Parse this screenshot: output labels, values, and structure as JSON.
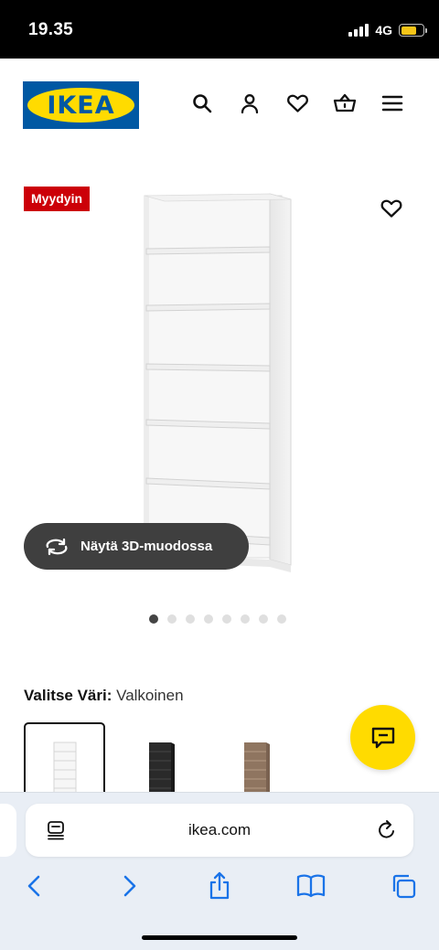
{
  "status_bar": {
    "time": "19.35",
    "network": "4G",
    "battery_level": 0.7
  },
  "header": {
    "logo_text": "IKEA",
    "icons": [
      "search-icon",
      "user-icon",
      "heart-icon",
      "basket-icon",
      "menu-icon"
    ]
  },
  "product": {
    "badge": "Myydyin",
    "view_3d_label": "Näytä 3D-muodossa",
    "image_count": 8,
    "active_image_index": 0,
    "color_label": "Valitse Väri:",
    "color_value": "Valkoinen",
    "swatches": [
      "white",
      "black",
      "brown"
    ]
  },
  "browser": {
    "url": "ikea.com",
    "nav_icons": [
      "back-icon",
      "forward-icon",
      "share-icon",
      "bookmarks-icon",
      "tabs-icon"
    ]
  },
  "colors": {
    "ikea_blue": "#0058a3",
    "ikea_yellow": "#ffdb00",
    "badge_red": "#cc0008"
  }
}
